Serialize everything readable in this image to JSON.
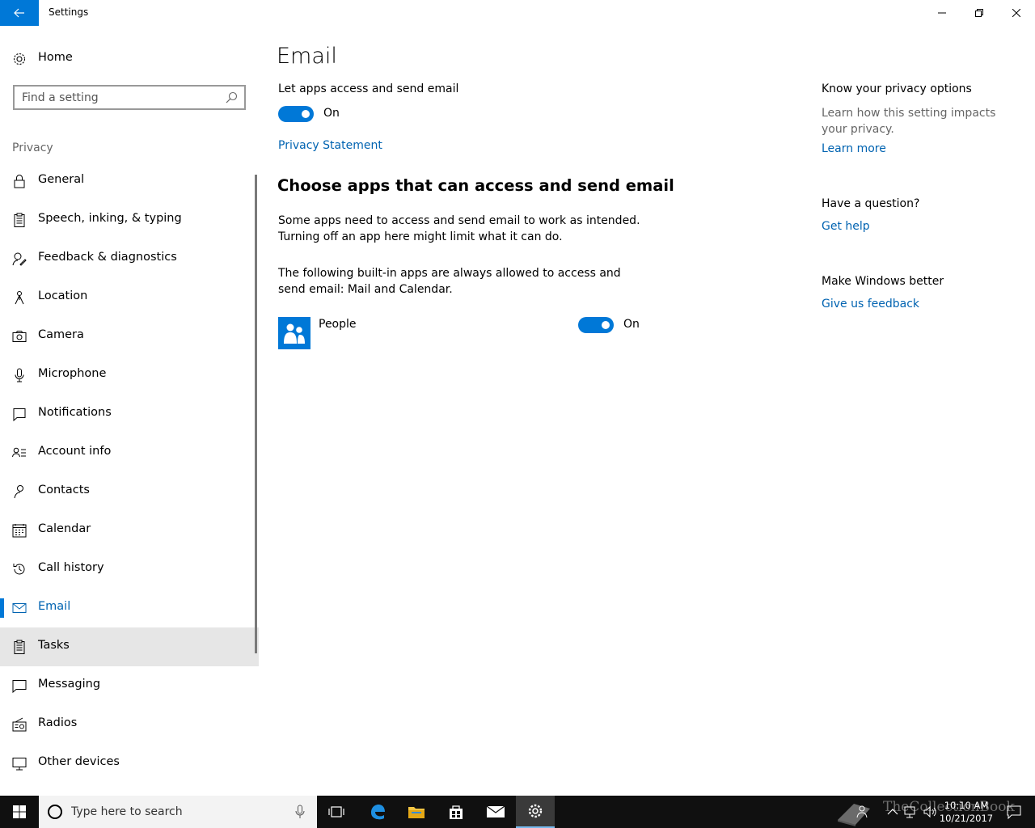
{
  "window": {
    "title": "Settings"
  },
  "sidebar": {
    "home_label": "Home",
    "search_placeholder": "Find a setting",
    "section": "Privacy",
    "items": [
      {
        "label": "General",
        "icon": "lock-icon"
      },
      {
        "label": "Speech, inking, & typing",
        "icon": "clipboard-icon"
      },
      {
        "label": "Feedback & diagnostics",
        "icon": "feedback-icon"
      },
      {
        "label": "Location",
        "icon": "location-icon"
      },
      {
        "label": "Camera",
        "icon": "camera-icon"
      },
      {
        "label": "Microphone",
        "icon": "microphone-icon"
      },
      {
        "label": "Notifications",
        "icon": "notification-icon"
      },
      {
        "label": "Account info",
        "icon": "account-info-icon"
      },
      {
        "label": "Contacts",
        "icon": "contacts-icon"
      },
      {
        "label": "Calendar",
        "icon": "calendar-icon"
      },
      {
        "label": "Call history",
        "icon": "history-icon"
      },
      {
        "label": "Email",
        "icon": "mail-icon"
      },
      {
        "label": "Tasks",
        "icon": "tasks-icon"
      },
      {
        "label": "Messaging",
        "icon": "message-icon"
      },
      {
        "label": "Radios",
        "icon": "radio-icon"
      },
      {
        "label": "Other devices",
        "icon": "devices-icon"
      }
    ],
    "selected": "Email",
    "hovered": "Tasks"
  },
  "main": {
    "title": "Email",
    "master_toggle": {
      "label": "Let apps access and send email",
      "state": "On"
    },
    "privacy_link": "Privacy Statement",
    "subheading": "Choose apps that can access and send email",
    "para1": "Some apps need to access and send email to work as intended. Turning off an app here might limit what it can do.",
    "para2": "The following built-in apps are always allowed to access and send email: Mail and Calendar.",
    "apps": [
      {
        "name": "People",
        "state": "On",
        "icon": "people-icon"
      }
    ]
  },
  "right_panel": {
    "privacy_heading": "Know your privacy options",
    "privacy_text": "Learn how this setting impacts your privacy.",
    "learn_more": "Learn more",
    "question_heading": "Have a question?",
    "get_help": "Get help",
    "better_heading": "Make Windows better",
    "feedback_link": "Give us feedback"
  },
  "taskbar": {
    "search_placeholder": "Type here to search",
    "time": "10:10 AM",
    "date": "10/21/2017",
    "watermark": "TheCollectionBook"
  },
  "colors": {
    "accent": "#0078d7",
    "link": "#0063b1",
    "taskbar": "#101010"
  }
}
